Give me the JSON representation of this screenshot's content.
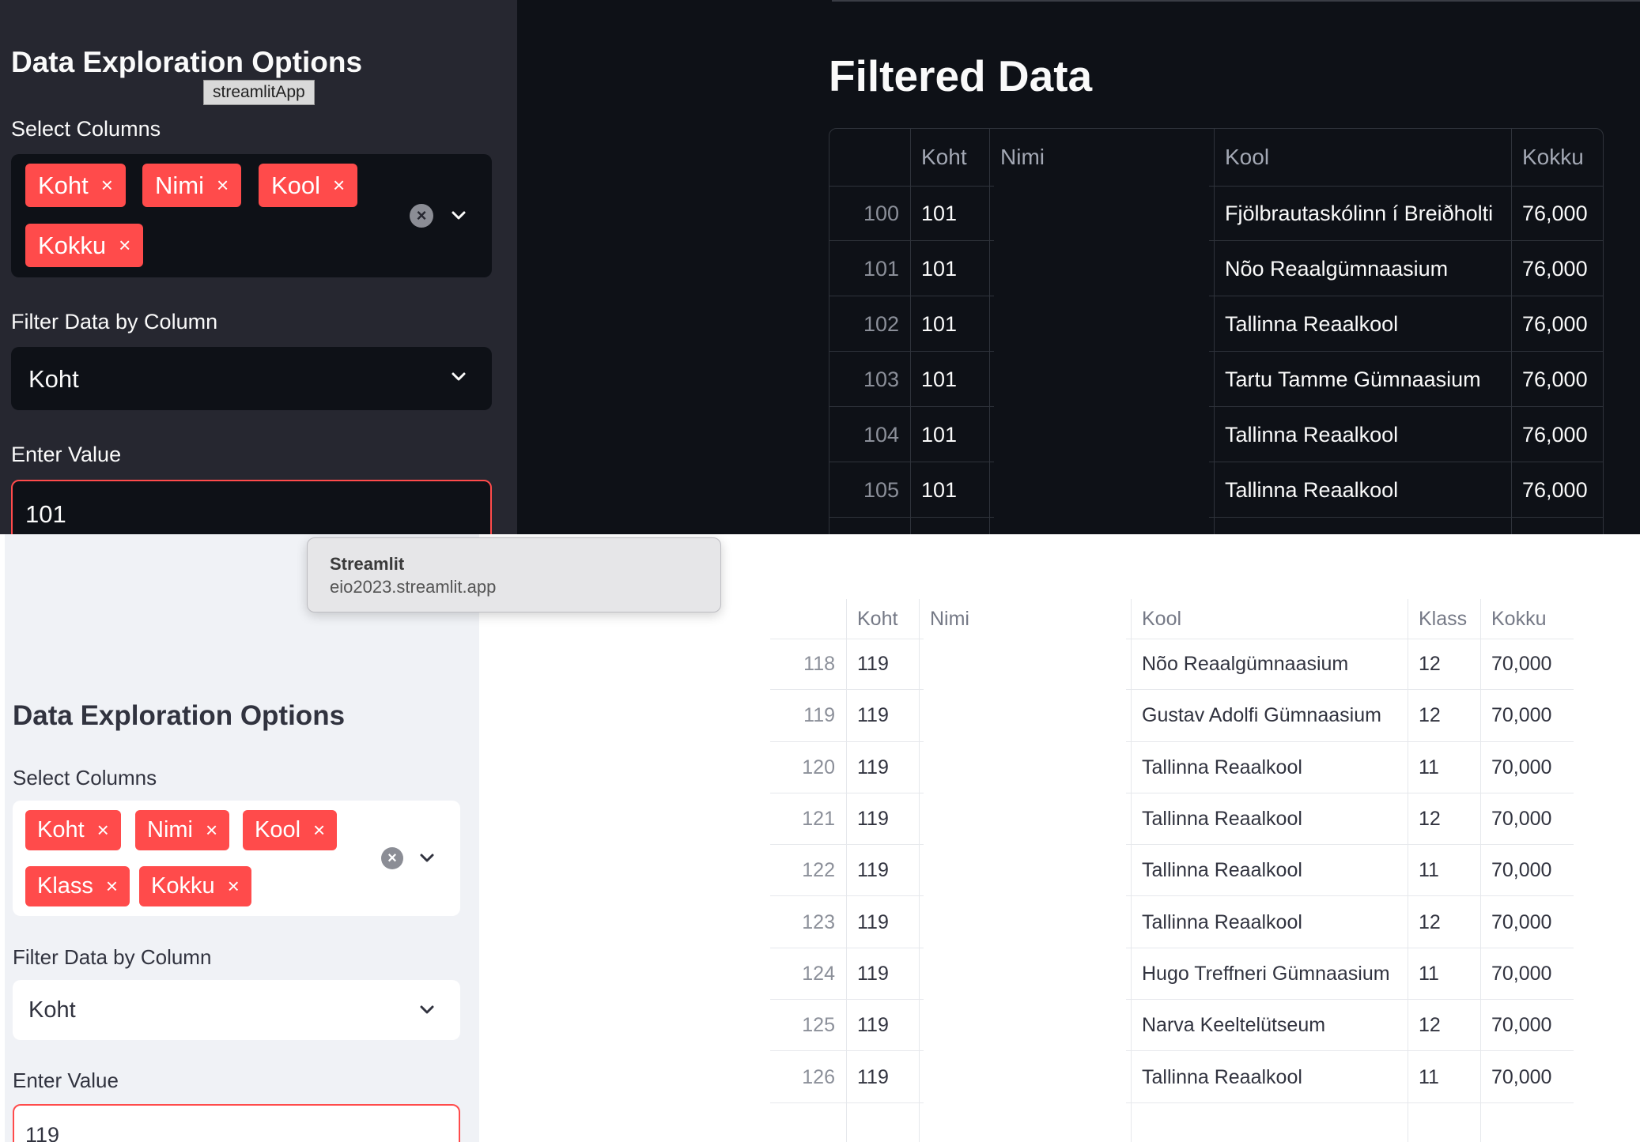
{
  "top": {
    "tooltip": "streamlitApp",
    "sidebar": {
      "title": "Data Exploration Options",
      "select_columns_label": "Select Columns",
      "chips": [
        "Koht",
        "Nimi",
        "Kool",
        "Kokku"
      ],
      "chip_remove": "×",
      "clear_symbol": "×",
      "filter_label": "Filter Data by Column",
      "filter_value": "Koht",
      "enter_label": "Enter Value",
      "enter_value": "101"
    },
    "main": {
      "title": "Filtered Data",
      "columns": [
        "",
        "Koht",
        "Nimi",
        "Kool",
        "Kokku"
      ],
      "rows": [
        [
          "100",
          "101",
          "",
          "Fjölbrautaskólinn í Breiðholti",
          "76,000"
        ],
        [
          "101",
          "101",
          "",
          "Nõo Reaalgümnaasium",
          "76,000"
        ],
        [
          "102",
          "101",
          "",
          "Tallinna Reaalkool",
          "76,000"
        ],
        [
          "103",
          "101",
          "",
          "Tartu Tamme Gümnaasium",
          "76,000"
        ],
        [
          "104",
          "101",
          "",
          "Tallinna Reaalkool",
          "76,000"
        ],
        [
          "105",
          "101",
          "",
          "Tallinna Reaalkool",
          "76,000"
        ]
      ]
    }
  },
  "popup": {
    "title": "Streamlit",
    "url": "eio2023.streamlit.app"
  },
  "bottom": {
    "sidebar": {
      "title": "Data Exploration Options",
      "select_columns_label": "Select Columns",
      "chips": [
        "Koht",
        "Nimi",
        "Kool",
        "Klass",
        "Kokku"
      ],
      "chip_remove": "×",
      "clear_symbol": "×",
      "filter_label": "Filter Data by Column",
      "filter_value": "Koht",
      "enter_label": "Enter Value",
      "enter_value": "119"
    },
    "main": {
      "columns": [
        "",
        "Koht",
        "Nimi",
        "Kool",
        "Klass",
        "Kokku"
      ],
      "rows": [
        [
          "118",
          "119",
          "",
          "Nõo Reaalgümnaasium",
          "12",
          "70,000"
        ],
        [
          "119",
          "119",
          "",
          "Gustav Adolfi Gümnaasium",
          "12",
          "70,000"
        ],
        [
          "120",
          "119",
          "",
          "Tallinna Reaalkool",
          "11",
          "70,000"
        ],
        [
          "121",
          "119",
          "",
          "Tallinna Reaalkool",
          "12",
          "70,000"
        ],
        [
          "122",
          "119",
          "",
          "Tallinna Reaalkool",
          "11",
          "70,000"
        ],
        [
          "123",
          "119",
          "",
          "Tallinna Reaalkool",
          "12",
          "70,000"
        ],
        [
          "124",
          "119",
          "",
          "Hugo Treffneri Gümnaasium",
          "11",
          "70,000"
        ],
        [
          "125",
          "119",
          "",
          "Narva Keeltelütseum",
          "12",
          "70,000"
        ],
        [
          "126",
          "119",
          "",
          "Tallinna Reaalkool",
          "11",
          "70,000"
        ]
      ]
    }
  },
  "colors": {
    "accent": "#ff4b4b",
    "dark_bg": "#0e1117",
    "dark_sidebar": "#262730",
    "light_sidebar": "#f0f2f6"
  },
  "icons": {
    "clear": "x-circle-icon",
    "dropdown": "chevron-down-icon",
    "remove": "close-icon"
  }
}
